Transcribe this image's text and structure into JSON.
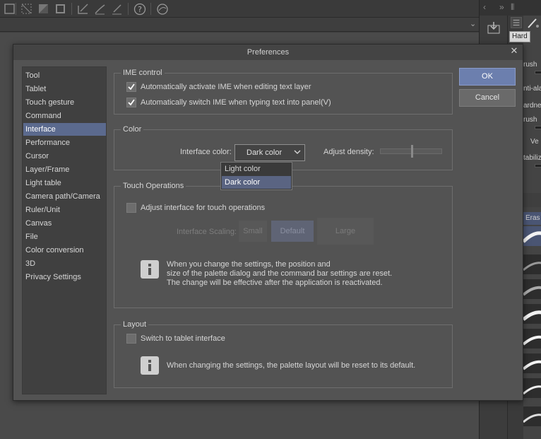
{
  "dialog": {
    "title": "Preferences",
    "close_glyph": "✕",
    "ok_label": "OK",
    "cancel_label": "Cancel"
  },
  "categories": [
    {
      "label": "Tool"
    },
    {
      "label": "Tablet"
    },
    {
      "label": "Touch gesture"
    },
    {
      "label": "Command"
    },
    {
      "label": "Interface",
      "active": true
    },
    {
      "label": "Performance"
    },
    {
      "label": "Cursor"
    },
    {
      "label": "Layer/Frame"
    },
    {
      "label": "Light table"
    },
    {
      "label": "Camera path/Camera"
    },
    {
      "label": "Ruler/Unit"
    },
    {
      "label": "Canvas"
    },
    {
      "label": "File"
    },
    {
      "label": "Color conversion"
    },
    {
      "label": "3D"
    },
    {
      "label": "Privacy Settings"
    }
  ],
  "ime": {
    "title": "IME control",
    "option1": {
      "label": "Automatically activate IME when editing text layer",
      "checked": true
    },
    "option2": {
      "label": "Automatically switch IME when typing text into panel(V)",
      "checked": true
    }
  },
  "color": {
    "title": "Color",
    "interface_label": "Interface color:",
    "interface_value": "Dark color",
    "density_label": "Adjust density:",
    "options": [
      "Light color",
      "Dark color"
    ],
    "selected_option": "Dark color"
  },
  "touch": {
    "title": "Touch Operations",
    "adjust_label": "Adjust interface for touch operations",
    "adjust_checked": false,
    "scaling_label": "Interface Scaling:",
    "scaling_options": [
      "Small",
      "Default",
      "Large"
    ],
    "scaling_selected": "Default",
    "info_lines": [
      "When you change the settings, the position and",
      "size of the palette dialog and the command bar settings are reset.",
      "The change will be effective after the application is reactivated."
    ]
  },
  "layout": {
    "title": "Layout",
    "switch_label": "Switch to tablet interface",
    "switch_checked": false,
    "info_line": "When changing the settings, the palette layout will be reset to its default."
  },
  "background": {
    "tooltip": "Hard",
    "panel_labels": [
      "rush",
      "nti-ala",
      "ardne",
      "rush",
      "Ve",
      "tabiliz",
      "Eras"
    ]
  },
  "colors": {
    "accent": "#5b6a8e",
    "ok_button": "#6c7fae",
    "dialog_bg": "#535353"
  }
}
